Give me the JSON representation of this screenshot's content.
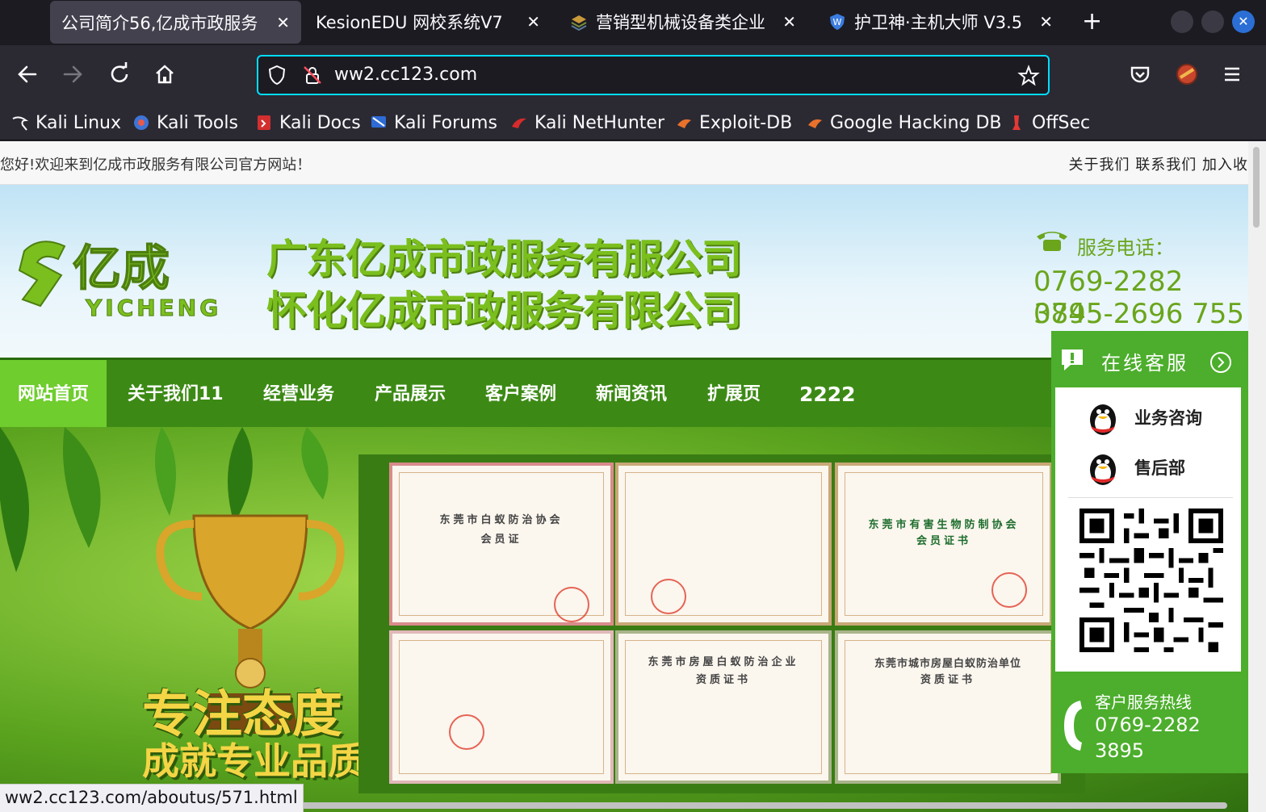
{
  "browser": {
    "tabs": [
      {
        "title": "公司简介56,亿成市政服务",
        "active": true
      },
      {
        "title": "KesionEDU 网校系统V7",
        "active": false
      },
      {
        "title": "营销型机械设备类企业",
        "active": false
      },
      {
        "title": "护卫神·主机大师 V3.5",
        "active": false
      }
    ],
    "url": "ww2.cc123.com",
    "bookmarks": [
      "Kali Linux",
      "Kali Tools",
      "Kali Docs",
      "Kali Forums",
      "Kali NetHunter",
      "Exploit-DB",
      "Google Hacking DB",
      "OffSec"
    ],
    "status_url": "ww2.cc123.com/aboutus/571.html"
  },
  "site": {
    "welcome": "您好!欢迎来到亿成市政服务有限公司官方网站！",
    "top_links": "关于我们 联系我们 加入收",
    "logo_text": "亿成",
    "logo_sub": "YICHENG",
    "company_line1": "广东亿成市政服务有服公司",
    "company_line2": "怀化亿成市政服务有限公司",
    "service_label": "服务电话：",
    "phone1": "0769-2282 3895",
    "phone2": "0745-2696 755",
    "nav": [
      "网站首页",
      "关于我们11",
      "经营业务",
      "产品展示",
      "客户案例",
      "新闻资讯",
      "扩展页",
      "2222"
    ],
    "slogan1": "专注态度",
    "slogan2": "成就专业品质",
    "certificates": [
      {
        "title": "东莞市白蚁防治协会",
        "subtitle": "会员证"
      },
      {
        "title": "",
        "subtitle": ""
      },
      {
        "title": "东莞市有害生物防制协会",
        "subtitle": "会员证书"
      },
      {
        "title": "",
        "subtitle": ""
      },
      {
        "title": "东莞市房屋白蚁防治企业",
        "subtitle": "资质证书"
      },
      {
        "title": "东莞市城市房屋白蚁防治单位",
        "subtitle": "资质证书"
      }
    ]
  },
  "customer_service": {
    "title": "在线客服",
    "items": [
      "业务咨询",
      "售后部"
    ],
    "hotline_label": "客户服务热线",
    "hotline_number": "0769-2282 3895"
  },
  "colors": {
    "brand_green": "#3c8a15",
    "nav_active": "#6fcd2e",
    "cs_green": "#4cae2c",
    "url_focus": "#00ddff"
  }
}
